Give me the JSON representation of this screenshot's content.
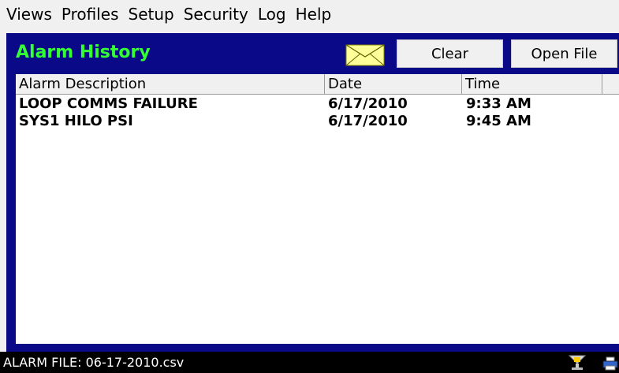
{
  "menu": {
    "items": [
      "Views",
      "Profiles",
      "Setup",
      "Security",
      "Log",
      "Help"
    ]
  },
  "panel": {
    "title": "Alarm History",
    "clear_label": "Clear",
    "open_file_label": "Open File",
    "envelope_icon": "envelope-icon"
  },
  "table": {
    "headers": [
      "Alarm Description",
      "Date",
      "Time"
    ],
    "rows": [
      {
        "description": "LOOP COMMS FAILURE",
        "date": "6/17/2010",
        "time": "9:33 AM"
      },
      {
        "description": "SYS1 HILO PSI",
        "date": "6/17/2010",
        "time": "9:45 AM"
      }
    ]
  },
  "status": {
    "text": "ALARM FILE: 06-17-2010.csv",
    "tray_icons": [
      "network-icon",
      "printer-icon"
    ]
  },
  "colors": {
    "panel_bg": "#0a0a88",
    "title_color": "#33ff33",
    "status_bg": "#000000"
  }
}
